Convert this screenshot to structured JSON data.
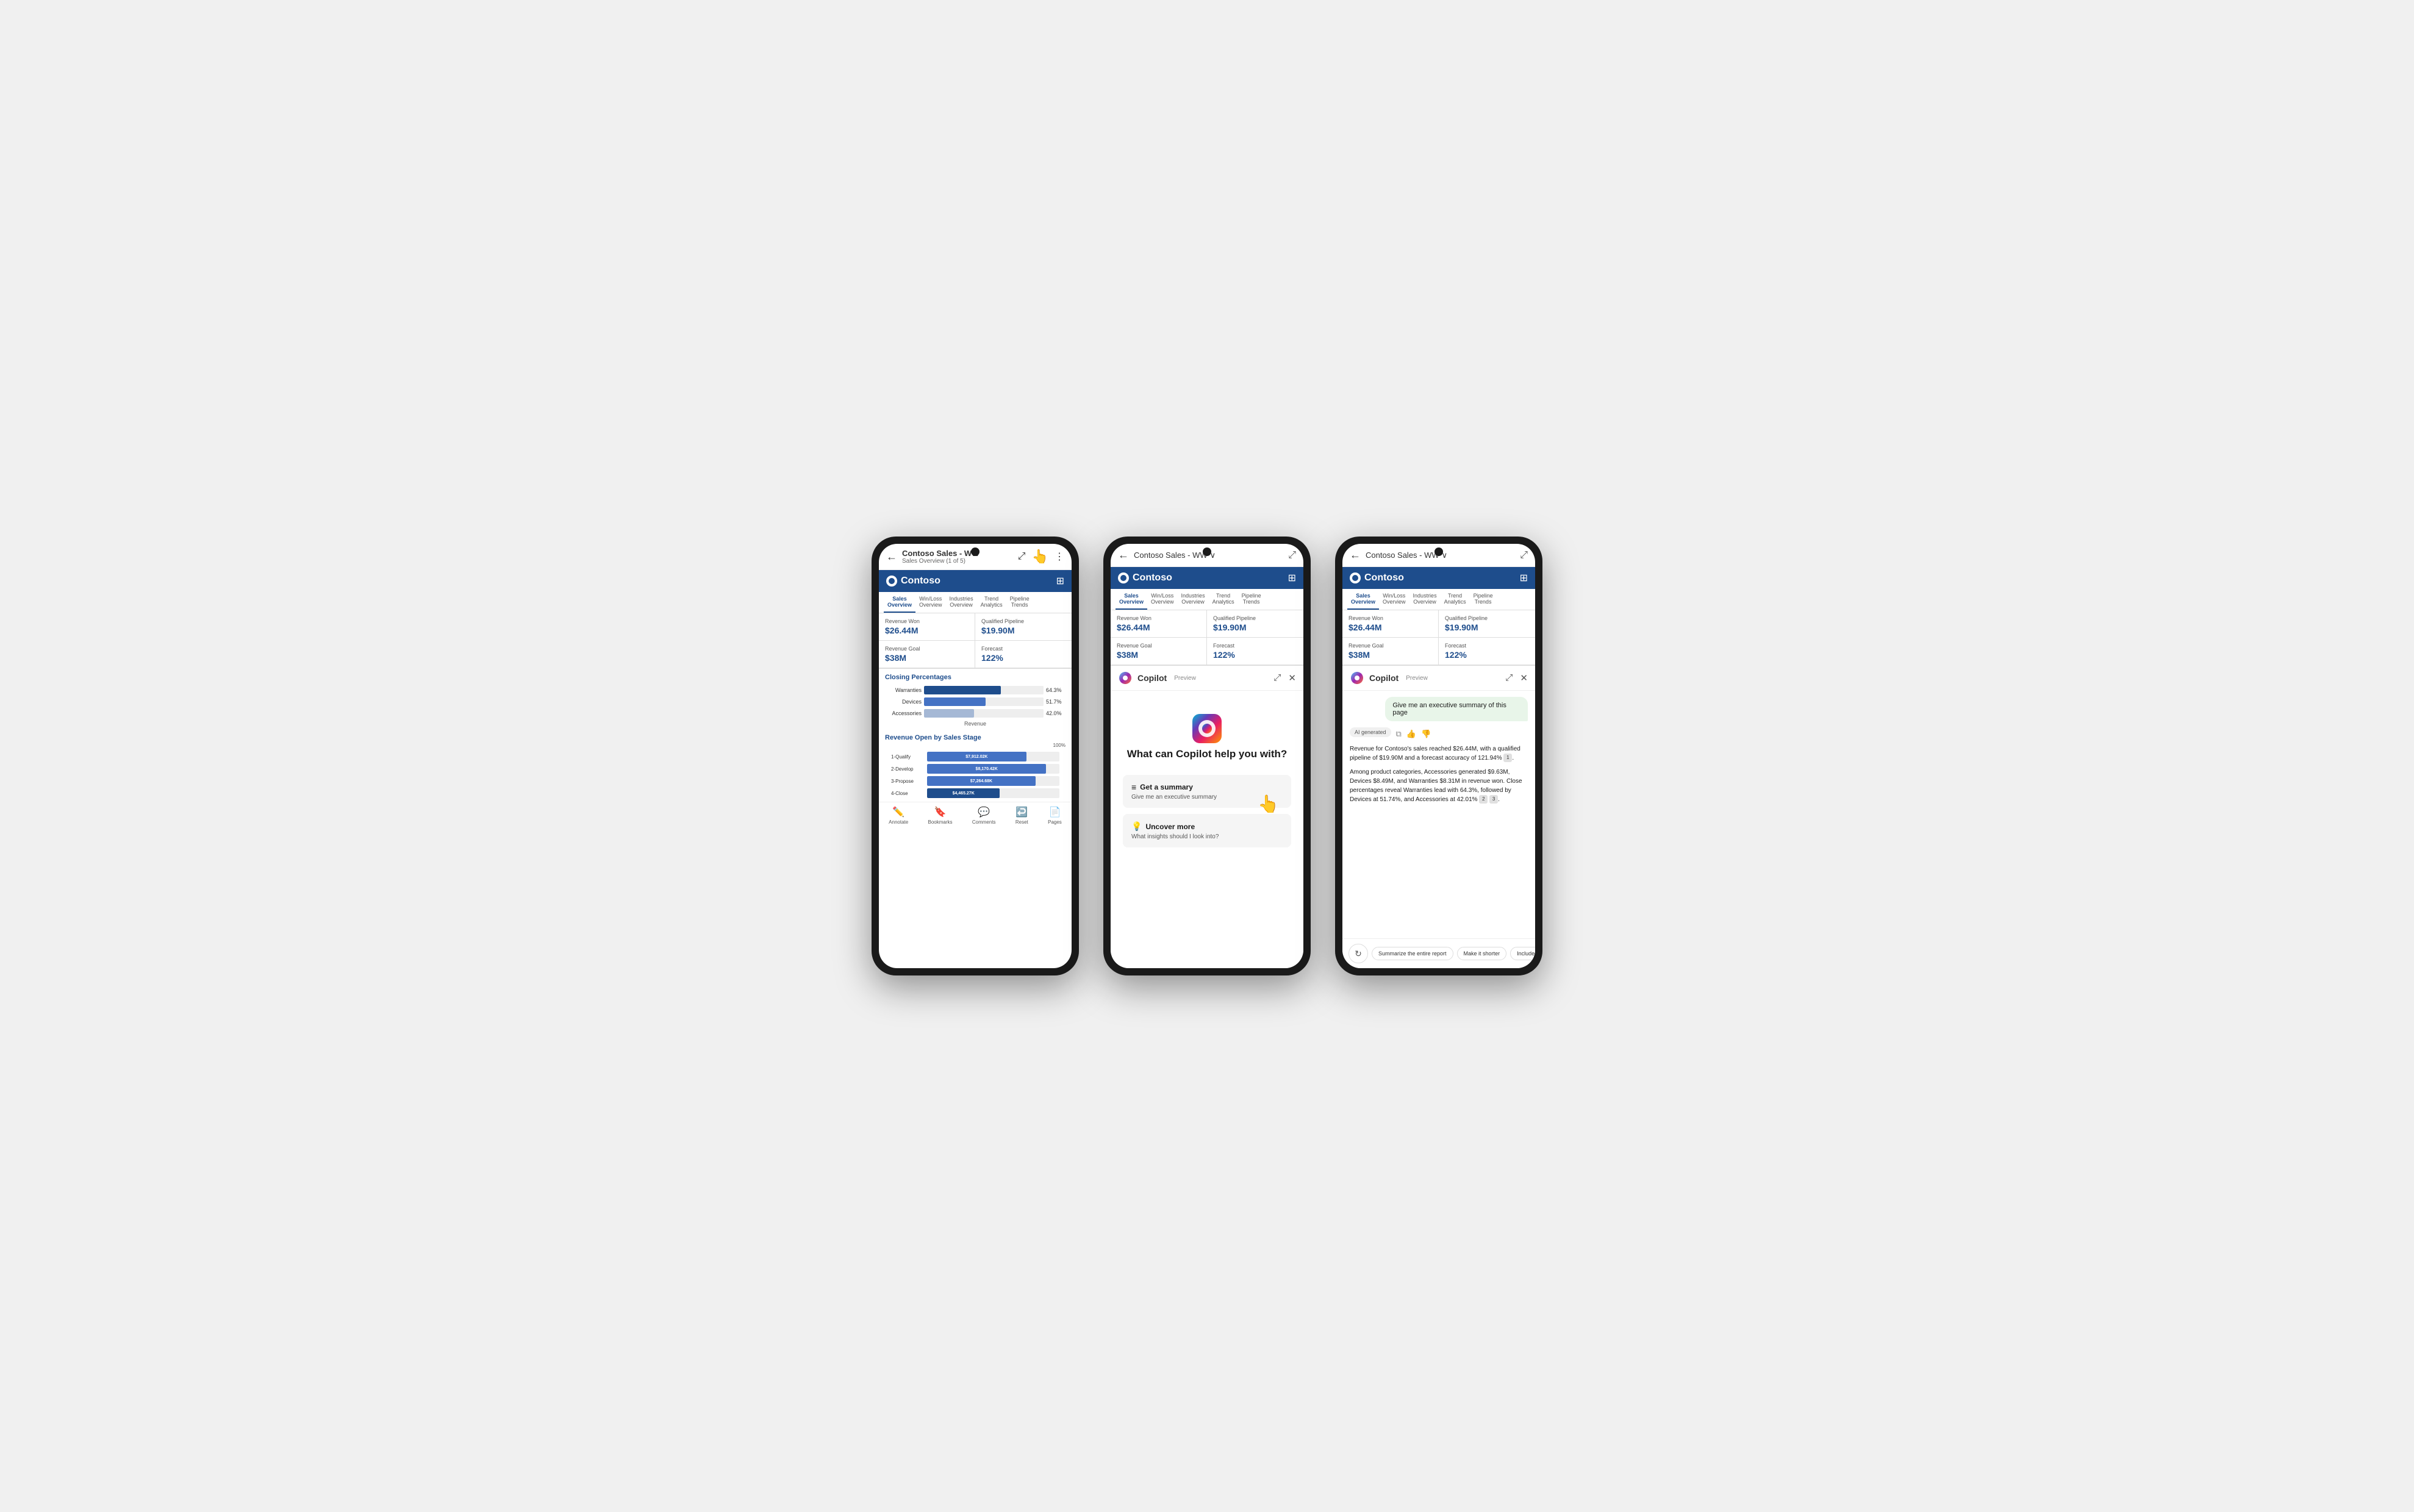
{
  "phones": [
    {
      "id": "phone1",
      "header": {
        "title": "Contoso Sales - WW",
        "subtitle": "Sales Overview (1 of 5)"
      },
      "brand": "Contoso",
      "tabs": [
        {
          "label": "Sales",
          "label2": "Overview",
          "active": true
        },
        {
          "label": "Win/Loss",
          "label2": "Overview",
          "active": false
        },
        {
          "label": "Industries",
          "label2": "Overview",
          "active": false
        },
        {
          "label": "Trend",
          "label2": "Analytics",
          "active": false
        },
        {
          "label": "Pipeline",
          "label2": "Trends",
          "active": false
        }
      ],
      "metrics": [
        {
          "label": "Revenue Won",
          "value": "$26.44M"
        },
        {
          "label": "Qualified Pipeline",
          "value": "$19.90M"
        },
        {
          "label": "Revenue Goal",
          "value": "$38M"
        },
        {
          "label": "Forecast",
          "value": "122%"
        }
      ],
      "closing_title": "Closing Percentages",
      "bars": [
        {
          "label": "Warranties",
          "pct": 64.3,
          "display": "64.3%"
        },
        {
          "label": "Devices",
          "pct": 51.7,
          "display": "51.7%"
        },
        {
          "label": "Accessories",
          "pct": 42.0,
          "display": "42.0%"
        }
      ],
      "bars_xlabel": "Revenue",
      "stages_title": "Revenue Open by Sales Stage",
      "stages": [
        {
          "label": "1-Qualify",
          "value": "$7,912.02K",
          "pct": 75
        },
        {
          "label": "2-Develop",
          "value": "$8,170.42K",
          "pct": 85
        },
        {
          "label": "3-Propose",
          "value": "$7,264.68K",
          "pct": 80
        },
        {
          "label": "4-Close",
          "value": "$4,465.27K",
          "pct": 50
        }
      ],
      "nav_items": [
        {
          "label": "Annotate",
          "icon": "✏️"
        },
        {
          "label": "Bookmarks",
          "icon": "🔖"
        },
        {
          "label": "Comments",
          "icon": "💬"
        },
        {
          "label": "Reset",
          "icon": "↩️"
        },
        {
          "label": "Pages",
          "icon": "📄"
        }
      ]
    },
    {
      "id": "phone2",
      "top_bar": {
        "title": "Contoso Sales - WW",
        "has_dropdown": true
      },
      "brand": "Contoso",
      "tabs": [
        {
          "label": "Sales",
          "label2": "Overview",
          "active": true
        },
        {
          "label": "Win/Loss",
          "label2": "Overview",
          "active": false
        },
        {
          "label": "Industries",
          "label2": "Overview",
          "active": false
        },
        {
          "label": "Trend",
          "label2": "Analytics",
          "active": false
        },
        {
          "label": "Pipeline",
          "label2": "Trends",
          "active": false
        }
      ],
      "metrics": [
        {
          "label": "Revenue Won",
          "value": "$26.44M"
        },
        {
          "label": "Qualified Pipeline",
          "value": "$19.90M"
        },
        {
          "label": "Revenue Goal",
          "value": "$38M"
        },
        {
          "label": "Forecast",
          "value": "122%"
        }
      ],
      "copilot": {
        "label": "Copilot",
        "preview": "Preview",
        "headline": "What can Copilot help you with?",
        "suggestions": [
          {
            "icon": "≡",
            "title": "Get a summary",
            "subtitle": "Give me an executive summary"
          },
          {
            "icon": "💡",
            "title": "Uncover more",
            "subtitle": "What insights should I look into?"
          }
        ]
      }
    },
    {
      "id": "phone3",
      "top_bar": {
        "title": "Contoso Sales - WW",
        "has_dropdown": true
      },
      "brand": "Contoso",
      "tabs": [
        {
          "label": "Sales",
          "label2": "Overview",
          "active": true
        },
        {
          "label": "Win/Loss",
          "label2": "Overview",
          "active": false
        },
        {
          "label": "Industries",
          "label2": "Overview",
          "active": false
        },
        {
          "label": "Trend",
          "label2": "Analytics",
          "active": false
        },
        {
          "label": "Pipeline",
          "label2": "Trends",
          "active": false
        }
      ],
      "metrics": [
        {
          "label": "Revenue Won",
          "value": "$26.44M"
        },
        {
          "label": "Qualified Pipeline",
          "value": "$19.90M"
        },
        {
          "label": "Revenue Goal",
          "value": "$38M"
        },
        {
          "label": "Forecast",
          "value": "122%"
        }
      ],
      "copilot": {
        "label": "Copilot",
        "preview": "Preview",
        "user_message": "Give me an executive summary of this page",
        "ai_badge": "AI generated",
        "ai_text1": "Revenue for Contoso's sales reached $26.44M, with a qualified pipeline of $19.90M and a forecast accuracy of 121.94%",
        "ai_text2": "Among product categories, Accessories generated $9.63M, Devices $8.49M, and Warranties $8.31M in revenue won. Close percentages reveal Warranties lead with 64.3%, followed by Devices at 51.74%, and Accessories at 42.01%",
        "action_chips": [
          "Summarize the entire report",
          "Make it shorter",
          "Include more details"
        ]
      }
    }
  ]
}
